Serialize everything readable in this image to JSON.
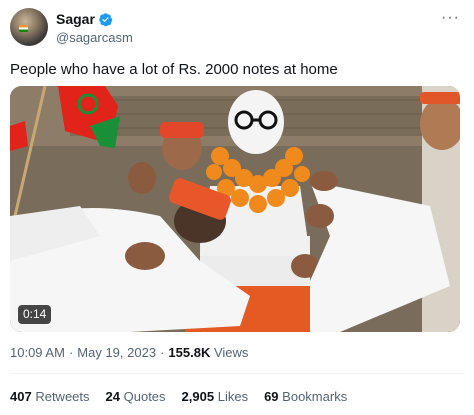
{
  "author": {
    "display_name": "Sagar",
    "handle": "@sagarcasm",
    "verified": true
  },
  "tweet": {
    "text": "People who have a lot of Rs. 2000 notes at home"
  },
  "media": {
    "type": "video",
    "duration": "0:14"
  },
  "meta": {
    "time": "10:09 AM",
    "date": "May 19, 2023",
    "views_count": "155.8K",
    "views_label": "Views"
  },
  "stats": {
    "retweets_count": "407",
    "retweets_label": "Retweets",
    "quotes_count": "24",
    "quotes_label": "Quotes",
    "likes_count": "2,905",
    "likes_label": "Likes",
    "bookmarks_count": "69",
    "bookmarks_label": "Bookmarks"
  },
  "colors": {
    "verified_blue": "#1d9bf0",
    "secondary_text": "#536471",
    "party_flag_red": "#e2231a",
    "party_flag_green": "#1a8f3a"
  },
  "icons": [
    "verified-badge-icon",
    "more-options-icon"
  ]
}
